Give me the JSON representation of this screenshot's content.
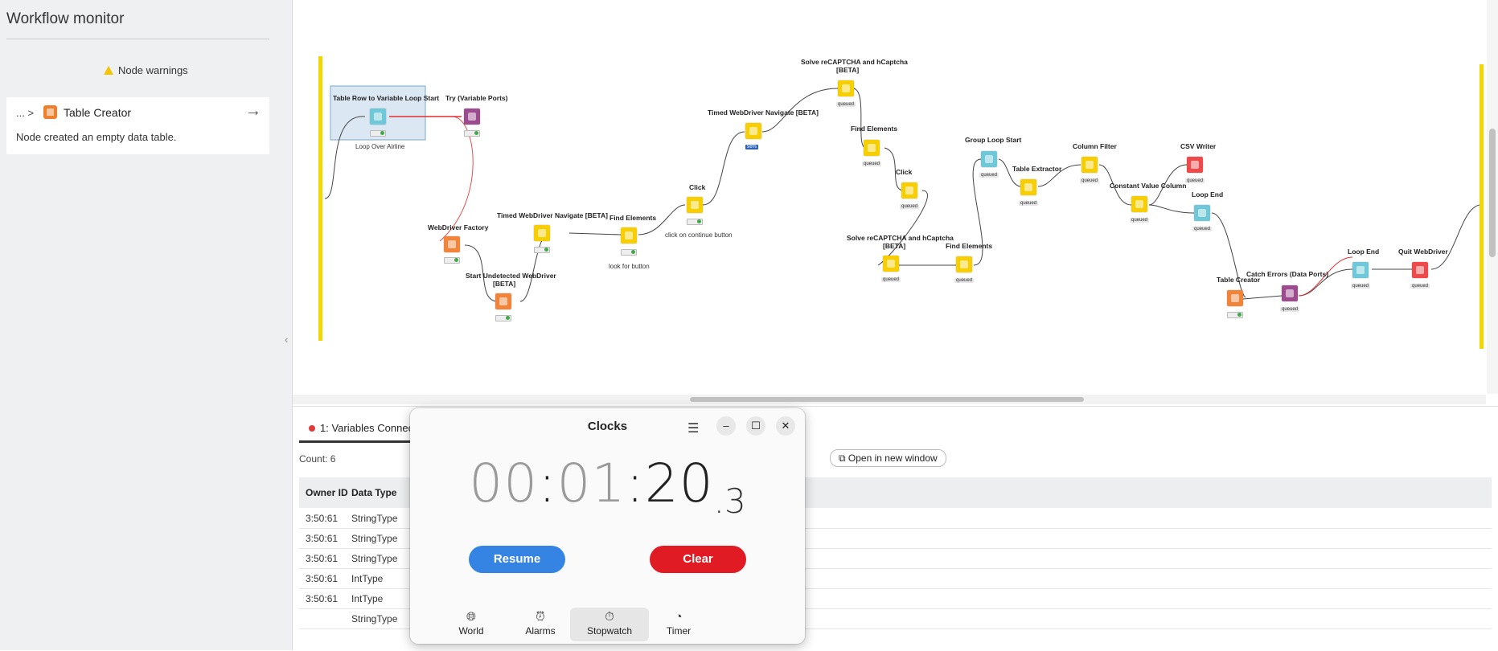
{
  "sidebar": {
    "title": "Workflow monitor",
    "warnings_heading": "Node warnings",
    "card": {
      "crumb": "... >",
      "node_name": "Table Creator",
      "message": "Node created an empty data table."
    }
  },
  "workflow": {
    "nodes": {
      "table_row_loop": {
        "label": "Table Row to Variable Loop Start",
        "sub": "Loop Over Airline"
      },
      "try_var": {
        "label": "Try (Variable Ports)"
      },
      "wd_factory": {
        "label": "WebDriver Factory"
      },
      "start_undetected": {
        "label1": "Start Undetected WebDriver",
        "label2": "[BETA]"
      },
      "timed_nav_1": {
        "label": "Timed WebDriver Navigate [BETA]"
      },
      "find_elements_1": {
        "label": "Find Elements",
        "sub": "look for button"
      },
      "click_1": {
        "label": "Click",
        "sub": "click on continue button"
      },
      "timed_nav_2": {
        "label": "Timed WebDriver Navigate [BETA]",
        "badge": "98%"
      },
      "solve_1": {
        "label1": "Solve reCAPTCHA and hCaptcha",
        "label2": "[BETA]"
      },
      "find_elements_2": {
        "label": "Find Elements"
      },
      "click_2": {
        "label": "Click"
      },
      "solve_2": {
        "label1": "Solve reCAPTCHA and hCaptcha",
        "label2": "[BETA]"
      },
      "find_elements_3": {
        "label": "Find Elements"
      },
      "group_loop": {
        "label": "Group Loop Start"
      },
      "table_extractor": {
        "label": "Table Extractor"
      },
      "column_filter": {
        "label": "Column Filter"
      },
      "constant_value": {
        "label": "Constant Value Column"
      },
      "csv_writer": {
        "label": "CSV Writer"
      },
      "loop_end_1": {
        "label": "Loop End"
      },
      "table_creator": {
        "label": "Table Creator"
      },
      "catch_errors": {
        "label": "Catch Errors (Data Ports)"
      },
      "loop_end_2": {
        "label": "Loop End"
      },
      "quit_wd": {
        "label": "Quit WebDriver"
      }
    },
    "queued_label": "queued"
  },
  "bottom_panel": {
    "tab_label": "1: Variables Connec",
    "count": "Count: 6",
    "open_new_window": "Open in new window",
    "columns": [
      "Owner ID",
      "Data Type"
    ],
    "rows": [
      {
        "owner": "3:50:61",
        "type": "StringType"
      },
      {
        "owner": "3:50:61",
        "type": "StringType"
      },
      {
        "owner": "3:50:61",
        "type": "StringType"
      },
      {
        "owner": "3:50:61",
        "type": "IntType"
      },
      {
        "owner": "3:50:61",
        "type": "IntType"
      },
      {
        "owner": "",
        "type": "StringType"
      }
    ]
  },
  "clocks": {
    "title": "Clocks",
    "stopwatch": {
      "hours": "00",
      "sep1": ":",
      "minutes": "01",
      "sep2": ":",
      "seconds": "20",
      "dot": ".",
      "centis": "3"
    },
    "resume_label": "Resume",
    "clear_label": "Clear",
    "nav": [
      {
        "label": "World",
        "icon": "world-icon"
      },
      {
        "label": "Alarms",
        "icon": "alarm-icon"
      },
      {
        "label": "Stopwatch",
        "icon": "stopwatch-icon"
      },
      {
        "label": "Timer",
        "icon": "timer-icon"
      }
    ],
    "active_tab": "Stopwatch"
  },
  "colors": {
    "accent_blue": "#3584e4",
    "destructive_red": "#e01b24",
    "knime_yellow": "#f7cf00"
  }
}
